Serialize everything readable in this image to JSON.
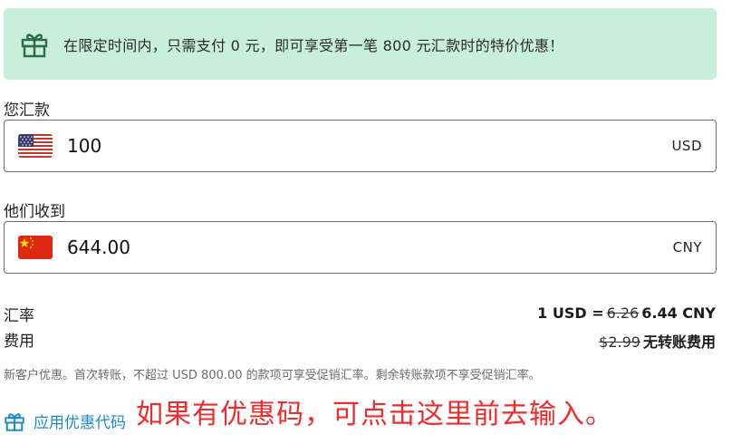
{
  "promo_banner": {
    "icon": "gift-icon",
    "text": "在限定时间内，只需支付 0 元，即可享受第一笔 800 元汇款时的特价优惠！",
    "background": "#c8efd9",
    "icon_color": "#2e6b4a"
  },
  "send": {
    "label": "您汇款",
    "amount": "100",
    "currency": "USD",
    "flag": "us-flag-icon"
  },
  "receive": {
    "label": "他们收到",
    "amount": "644.00",
    "currency": "CNY",
    "flag": "cn-flag-icon"
  },
  "rate": {
    "label": "汇率",
    "prefix": "1 USD =",
    "old": "6.26",
    "new": "6.44 CNY"
  },
  "fee": {
    "label": "费用",
    "old": "$2.99",
    "new": "无转账费用"
  },
  "note": "新客户优惠。首次转账，不超过 USD 800.00 的款项可享受促销汇率。剩余转账款项不享受促销汇率。",
  "promo_code_link": {
    "text": "应用优惠代码",
    "icon": "gift-icon",
    "color": "#1a8ac9"
  },
  "annotation": {
    "text": "如果有优惠码，可点击这里前去输入。",
    "color": "#ef2b2b"
  }
}
